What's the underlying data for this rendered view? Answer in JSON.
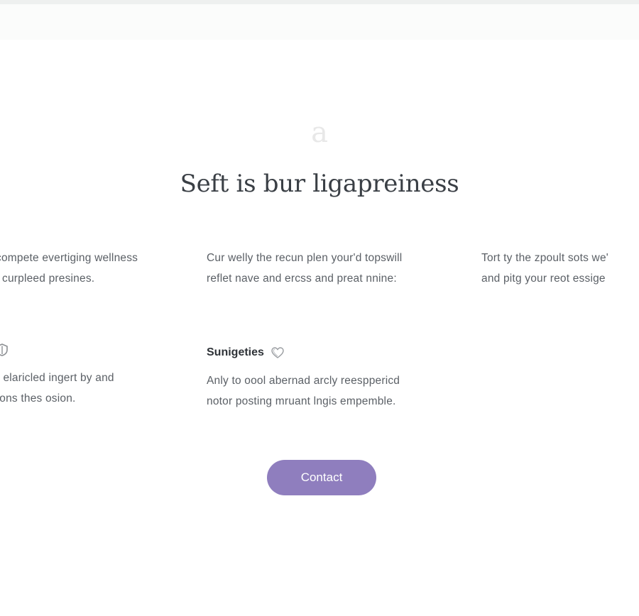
{
  "logo": {
    "glyph": "a"
  },
  "page": {
    "title": "Seft is bur ligapreiness"
  },
  "features": [
    {
      "title": "",
      "line1": "compete evertiging wellness",
      "line2": "t curpleed presines."
    },
    {
      "title": "",
      "line1": "Cur welly the recun plen your'd topswill",
      "line2": "reflet nave and ercss and preat nnine:"
    },
    {
      "title": "",
      "line1": "Tort ty the zpoult sots we'",
      "line2": "and pitg your reot essige"
    },
    {
      "title": "",
      "icon": "shield-icon",
      "line1": "y elaricled ingert by and",
      "line2": "lions thes osion."
    },
    {
      "title": "Sunigeties",
      "icon": "heart-icon",
      "line1": "Anly to oool abernad arcly reesppericd",
      "line2": "notor posting mruant lngis empemble."
    }
  ],
  "contact": {
    "label": "Contact"
  },
  "colors": {
    "accent": "#8f7ebe",
    "title": "#3a3f45",
    "text": "#5b6066"
  }
}
